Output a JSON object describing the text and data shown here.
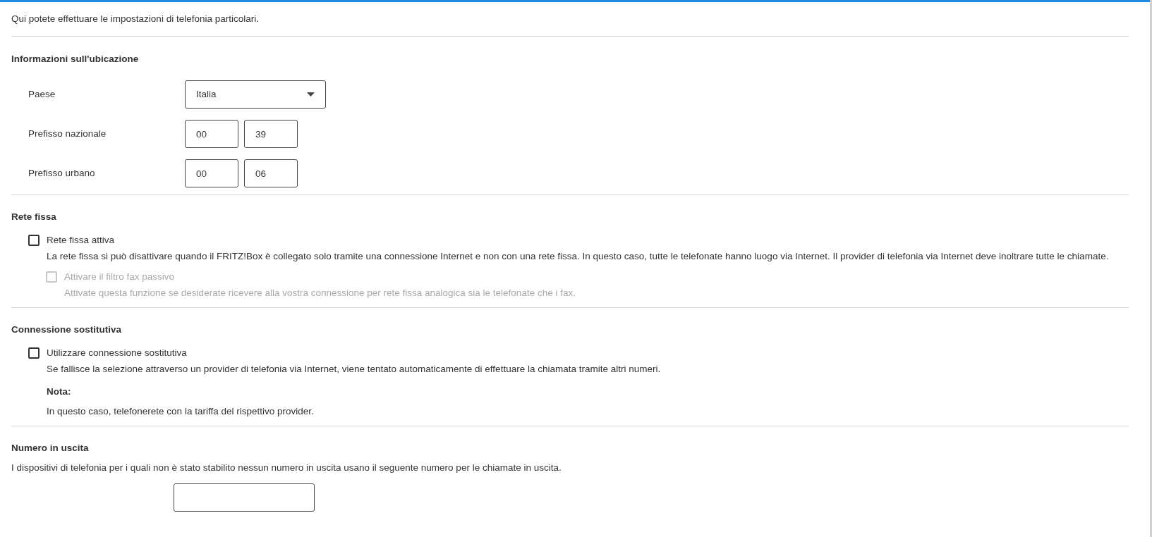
{
  "intro": "Qui potete effettuare le impostazioni di telefonia particolari.",
  "location": {
    "heading": "Informazioni sull'ubicazione",
    "rows": [
      {
        "kind": "select",
        "label": "Paese",
        "value": "Italia"
      },
      {
        "kind": "pair",
        "label": "Prefisso nazionale",
        "values": [
          "00",
          "39"
        ]
      },
      {
        "kind": "pair",
        "label": "Prefisso urbano",
        "values": [
          "00",
          "06"
        ]
      }
    ]
  },
  "landline": {
    "heading": "Rete fissa",
    "option": {
      "label": "Rete fissa attiva",
      "checked": false,
      "disabled": false,
      "description": "La rete fissa si può disattivare quando il FRITZ!Box è collegato solo tramite una connessione Internet e non con una rete fissa. In questo caso, tutte le telefonate hanno luogo via Internet. Il provider di telefonia via Internet deve inoltrare tutte le chiamate."
    },
    "sub_option": {
      "label": "Attivare il filtro fax passivo",
      "checked": false,
      "disabled": true,
      "description": "Attivate questa funzione se desiderate ricevere alla vostra connessione per rete fissa analogica sia le telefonate che i fax."
    }
  },
  "fallback": {
    "heading": "Connessione sostitutiva",
    "option": {
      "label": "Utilizzare connessione sostitutiva",
      "checked": false,
      "disabled": false,
      "description": "Se fallisce la selezione attraverso un provider di telefonia via Internet, viene tentato automaticamente di effettuare la chiamata tramite altri numeri."
    },
    "note_title": "Nota:",
    "note_text": "In questo caso, telefonerete con la tariffa del rispettivo provider."
  },
  "outgoing": {
    "heading": "Numero in uscita",
    "text": "I dispositivi di telefonia per i quali non è stato stabilito nessun numero in uscita usano il seguente numero per le chiamate in uscita."
  }
}
